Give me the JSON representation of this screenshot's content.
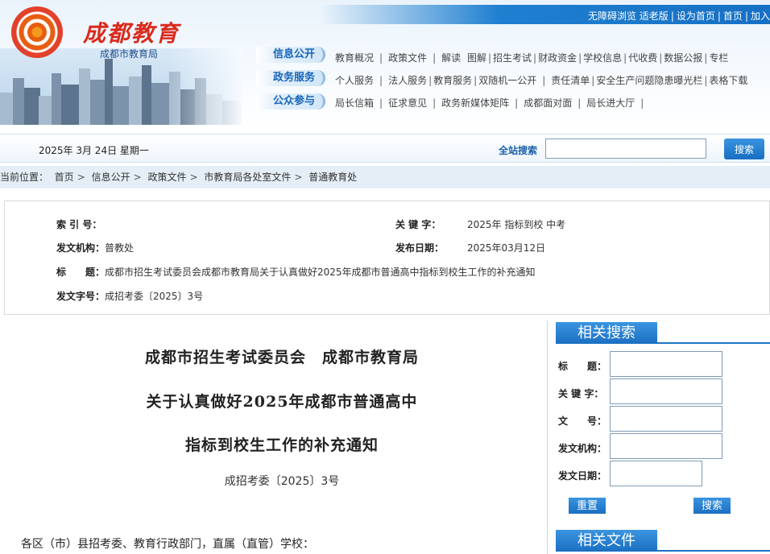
{
  "header": {
    "logo_title": "成都教育",
    "logo_subtitle": "成都市教育局",
    "quick_links": [
      "无障碍浏览",
      "适老版",
      "设为首页",
      "首页",
      "加入"
    ],
    "nav_labels": [
      "信息公开",
      "政务服务",
      "公众参与"
    ],
    "nav_rows": [
      [
        "教育概况",
        "政策文件",
        "解读",
        "图解",
        "招生考试",
        "财政资金",
        "学校信息",
        "代收费",
        "数据公报",
        "专栏"
      ],
      [
        "个人服务",
        "法人服务",
        "教育服务",
        "双随机一公开",
        "责任清单",
        "安全生产问题隐患曝光栏",
        "表格下载"
      ],
      [
        "局长信箱",
        "征求意见",
        "政务新媒体矩阵",
        "成都面对面",
        "局长进大厅"
      ]
    ]
  },
  "datebar": {
    "date": "2025年 3月 24日 星期一",
    "search_label": "全站搜索",
    "search_value": "",
    "search_button": "搜索"
  },
  "breadcrumb": {
    "label": "当前位置：",
    "items": [
      "首页",
      "信息公开",
      "政策文件",
      "市教育局各处室文件",
      "普通教育处"
    ]
  },
  "info": {
    "index_label": "索 引 号：",
    "index_value": "",
    "keyword_label": "关 键 字：",
    "keyword_value": "2025年 指标到校 中考",
    "org_label": "发文机构：",
    "org_value": "普教处",
    "date_label": "发布日期：",
    "date_value": "2025年03月12日",
    "title_label": "标　　题：",
    "title_value": "成都市招生考试委员会成都市教育局关于认真做好2025年成都市普通高中指标到校生工作的补充通知",
    "docno_label": "发文字号：",
    "docno_value": "成招考委〔2025〕3号"
  },
  "document": {
    "title_lines": [
      "成都市招生考试委员会　成都市教育局",
      "关于认真做好2025年成都市普通高中",
      "指标到校生工作的补充通知"
    ],
    "doc_number": "成招考委〔2025〕3号",
    "salutation": "各区（市）县招考委、教育行政部门，直属（直管）学校："
  },
  "sidebar": {
    "search_heading": "相关搜索",
    "fields": [
      {
        "label": "标　　题：",
        "value": ""
      },
      {
        "label": "关 键 字：",
        "value": ""
      },
      {
        "label": "文　　号：",
        "value": ""
      },
      {
        "label": "发文机构：",
        "value": ""
      },
      {
        "label": "发文日期：",
        "value": ""
      }
    ],
    "reset_button": "重置",
    "search_button": "搜索",
    "files_heading": "相关文件"
  },
  "colors": {
    "brand_blue": "#1670c4",
    "logo_red": "#d92a1c",
    "breadcrumb_bg": "#e5eef7"
  }
}
